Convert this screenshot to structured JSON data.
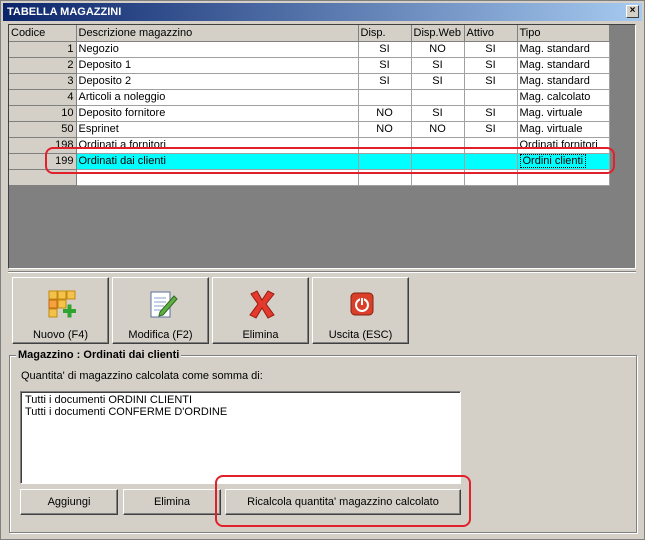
{
  "window": {
    "title": "TABELLA MAGAZZINI",
    "close_label": "×"
  },
  "grid": {
    "headers": [
      "Codice",
      "Descrizione magazzino",
      "Disp.",
      "Disp.Web",
      "Attivo",
      "Tipo"
    ],
    "rows": [
      {
        "code": "1",
        "desc": "Negozio",
        "disp": "SI",
        "web": "NO",
        "attivo": "SI",
        "tipo": "Mag. standard"
      },
      {
        "code": "2",
        "desc": "Deposito 1",
        "disp": "SI",
        "web": "SI",
        "attivo": "SI",
        "tipo": "Mag. standard"
      },
      {
        "code": "3",
        "desc": "Deposito 2",
        "disp": "SI",
        "web": "SI",
        "attivo": "SI",
        "tipo": "Mag. standard"
      },
      {
        "code": "4",
        "desc": "Articoli a noleggio",
        "disp": "",
        "web": "",
        "attivo": "",
        "tipo": "Mag. calcolato"
      },
      {
        "code": "10",
        "desc": "Deposito fornitore",
        "disp": "NO",
        "web": "SI",
        "attivo": "SI",
        "tipo": "Mag. virtuale"
      },
      {
        "code": "50",
        "desc": "Esprinet",
        "disp": "NO",
        "web": "NO",
        "attivo": "SI",
        "tipo": "Mag. virtuale"
      },
      {
        "code": "198",
        "desc": "Ordinati a fornitori",
        "disp": "",
        "web": "",
        "attivo": "",
        "tipo": "Ordinati fornitori"
      },
      {
        "code": "199",
        "desc": "Ordinati dai clienti",
        "disp": "",
        "web": "",
        "attivo": "",
        "tipo": "Ordini clienti"
      },
      {
        "code": "",
        "desc": "",
        "disp": "",
        "web": "",
        "attivo": "",
        "tipo": ""
      }
    ],
    "selected_index": 7
  },
  "toolbar": {
    "new_label": "Nuovo (F4)",
    "edit_label": "Modifica (F2)",
    "delete_label": "Elimina",
    "exit_label": "Uscita (ESC)"
  },
  "group": {
    "title": "Magazzino : Ordinati dai clienti",
    "description": "Quantita' di magazzino calcolata come somma di:",
    "list_items": [
      "Tutti i documenti ORDINI CLIENTI",
      "Tutti i documenti CONFERME D'ORDINE"
    ],
    "add_label": "Aggiungi",
    "delete_label": "Elimina",
    "recalc_label": "Ricalcola quantita' magazzino calcolato"
  },
  "colors": {
    "selected_row": "#00ffff",
    "highlight": "#e0202a",
    "title_bar": "#0a246a"
  }
}
